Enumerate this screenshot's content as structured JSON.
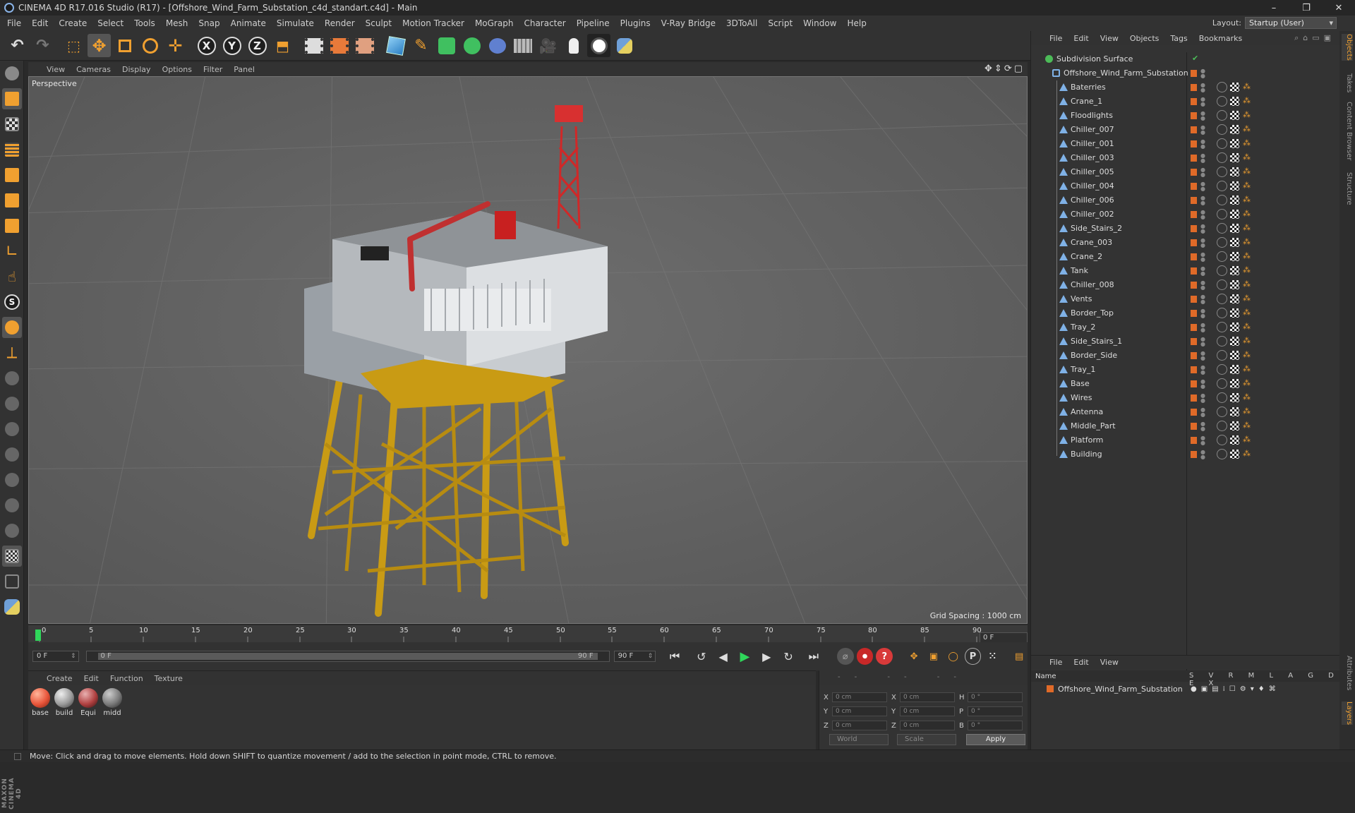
{
  "window": {
    "title": "CINEMA 4D R17.016 Studio (R17) - [Offshore_Wind_Farm_Substation_c4d_standart.c4d] - Main",
    "controls": [
      "–",
      "❐",
      "✕"
    ]
  },
  "menubar": {
    "items": [
      "File",
      "Edit",
      "Create",
      "Select",
      "Tools",
      "Mesh",
      "Snap",
      "Animate",
      "Simulate",
      "Render",
      "Sculpt",
      "Motion Tracker",
      "MoGraph",
      "Character",
      "Pipeline",
      "Plugins",
      "V-Ray Bridge",
      "3DToAll",
      "Script",
      "Window",
      "Help"
    ],
    "layout_label": "Layout:",
    "layout_value": "Startup (User)"
  },
  "toolbar": {
    "axis_x": "X",
    "axis_y": "Y",
    "axis_z": "Z"
  },
  "viewport": {
    "menu": [
      "View",
      "Cameras",
      "Display",
      "Options",
      "Filter",
      "Panel"
    ],
    "label": "Perspective",
    "grid_spacing": "Grid Spacing : 1000 cm"
  },
  "timeline": {
    "ticks": [
      "0",
      "5",
      "10",
      "15",
      "20",
      "25",
      "30",
      "35",
      "40",
      "45",
      "50",
      "55",
      "60",
      "65",
      "70",
      "75",
      "80",
      "85",
      "90"
    ],
    "current_frame": "0 F",
    "start_field": "0 F",
    "range_start": "0 F",
    "range_end": "90 F",
    "end_field": "90 F",
    "end_box": "0 F"
  },
  "materials": {
    "menu": [
      "Create",
      "Edit",
      "Function",
      "Texture"
    ],
    "items": [
      {
        "name": "base",
        "color": "#e8553a"
      },
      {
        "name": "build",
        "color": "#9a9a9a"
      },
      {
        "name": "Equi",
        "color": "#b04040"
      },
      {
        "name": "midd",
        "color": "#7a7a7a"
      }
    ]
  },
  "coords": {
    "header": "-- -- --",
    "rows": [
      {
        "a1": "X",
        "v1": "0 cm",
        "a2": "X",
        "v2": "0 cm",
        "a3": "H",
        "v3": "0 °"
      },
      {
        "a1": "Y",
        "v1": "0 cm",
        "a2": "Y",
        "v2": "0 cm",
        "a3": "P",
        "v3": "0 °"
      },
      {
        "a1": "Z",
        "v1": "0 cm",
        "a2": "Z",
        "v2": "0 cm",
        "a3": "B",
        "v3": "0 °"
      }
    ],
    "world": "World",
    "scale": "Scale",
    "apply": "Apply"
  },
  "status": "Move: Click and drag to move elements. Hold down SHIFT to quantize movement / add to the selection in point mode, CTRL to remove.",
  "objects_panel": {
    "menu": [
      "File",
      "Edit",
      "View",
      "Objects",
      "Tags",
      "Bookmarks"
    ],
    "root": "Subdivision Surface",
    "group": "Offshore_Wind_Farm_Substation",
    "children": [
      "Baterries",
      "Crane_1",
      "Floodlights",
      "Chiller_007",
      "Chiller_001",
      "Chiller_003",
      "Chiller_005",
      "Chiller_004",
      "Chiller_006",
      "Chiller_002",
      "Side_Stairs_2",
      "Crane_003",
      "Crane_2",
      "Tank",
      "Chiller_008",
      "Vents",
      "Border_Top",
      "Tray_2",
      "Side_Stairs_1",
      "Border_Side",
      "Tray_1",
      "Base",
      "Wires",
      "Antenna",
      "Middle_Part",
      "Platform",
      "Building"
    ]
  },
  "layers_panel": {
    "menu": [
      "File",
      "Edit",
      "View"
    ],
    "name_header": "Name",
    "cols": "S V R M L A G D E X",
    "layer": "Offshore_Wind_Farm_Substation"
  },
  "side_tabs": [
    "Objects",
    "Takes",
    "Content Browser",
    "Structure",
    "Attributes",
    "Layers"
  ],
  "branding": "MAXON CINEMA 4D"
}
